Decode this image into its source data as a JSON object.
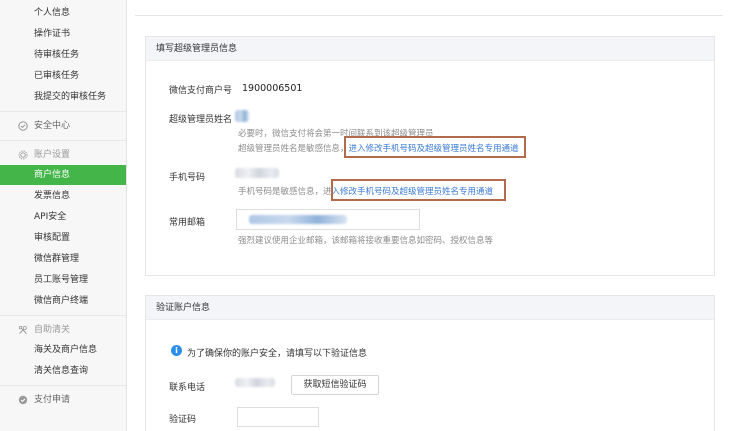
{
  "sidebar": {
    "items_top": [
      {
        "label": "个人信息"
      },
      {
        "label": "操作证书"
      },
      {
        "label": "待审核任务"
      },
      {
        "label": "已审核任务"
      },
      {
        "label": "我提交的审核任务"
      }
    ],
    "security": {
      "label": "安全中心"
    },
    "account_settings": {
      "label": "账户设置"
    },
    "account_items": [
      {
        "label": "商户信息",
        "active": true
      },
      {
        "label": "发票信息"
      },
      {
        "label": "API安全"
      },
      {
        "label": "审核配置"
      },
      {
        "label": "微信群管理"
      },
      {
        "label": "员工账号管理"
      },
      {
        "label": "微信商户终端"
      }
    ],
    "self_clear": {
      "label": "自助清关"
    },
    "clear_items": [
      {
        "label": "海关及商户信息"
      },
      {
        "label": "清关信息查询"
      }
    ],
    "payment_apply": {
      "label": "支付申请"
    },
    "active_color": "#44b549"
  },
  "form": {
    "section_title": "填写超级管理员信息",
    "merchant_id_label": "微信支付商户号",
    "merchant_id_value": "1900006501",
    "admin_name_label": "超级管理员姓名",
    "admin_name_hint1": "必要时，微信支付将会第一时间联系到该超级管理员",
    "admin_name_hint2_prefix": "超级管理员姓名是敏感信息，",
    "admin_name_hint2_link": "进入修改手机号码及超级管理员姓名专用通道",
    "phone_label": "手机号码",
    "phone_hint_prefix": "手机号码是敏感信息，进",
    "phone_hint_link": "入修改手机号码及超级管理员姓名专用通道",
    "email_label": "常用邮箱",
    "email_hint": "强烈建议使用企业邮箱，该邮箱将接收重要信息如密码、授权信息等"
  },
  "verify": {
    "section_title": "验证账户信息",
    "notice": "为了确保你的账户安全，请填写以下验证信息",
    "contact_label": "联系电话",
    "sms_button": "获取短信验证码",
    "code_label": "验证码"
  },
  "colors": {
    "accent": "#44b549",
    "link": "#3a7cd3",
    "highlight_box": "#b26c4d",
    "info": "#2b8ee8"
  }
}
